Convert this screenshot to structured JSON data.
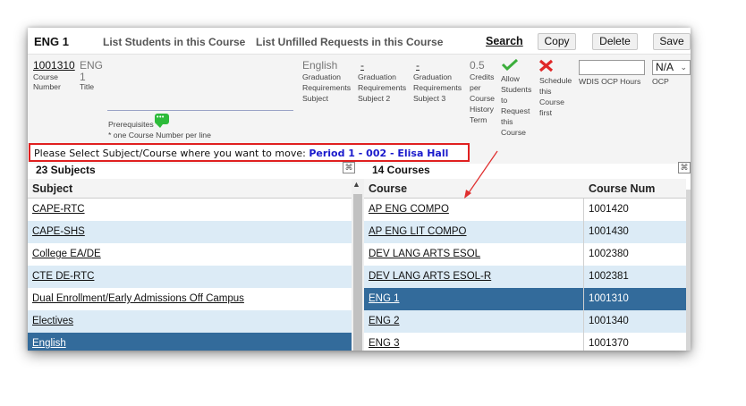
{
  "header": {
    "course_code": "ENG 1",
    "link_students": "List Students in this Course",
    "link_unfilled": "List Unfilled Requests in this Course",
    "search_label": "Search",
    "copy_label": "Copy",
    "delete_label": "Delete",
    "save_label": "Save"
  },
  "course": {
    "number_value": "1001310",
    "number_label_1": "Course",
    "number_label_2": "Number",
    "title_value_1": "ENG",
    "title_value_2": "1",
    "title_label": "Title",
    "grad_subject_value": "English",
    "grad_subject_label": [
      "Graduation",
      "Requirements",
      "Subject"
    ],
    "grad_subject2_value": "-",
    "grad_subject2_label": [
      "Graduation",
      "Requirements",
      "Subject 2"
    ],
    "grad_subject3_value": "-",
    "grad_subject3_label": [
      "Graduation",
      "Requirements",
      "Subject 3"
    ],
    "credits_value": "0.5",
    "credits_label": [
      "Credits",
      "per",
      "Course",
      "History",
      "Term"
    ],
    "allow_label": [
      "Allow",
      "Students",
      "to",
      "Request",
      "this",
      "Course"
    ],
    "schedule_label": [
      "Schedule",
      "this",
      "Course",
      "first"
    ],
    "wdis_label": "WDIS OCP Hours",
    "wdis_value": "",
    "ocp_value": "N/A",
    "ocp_label": "OCP",
    "prereq_label": "Prerequisites",
    "prereq_note": "* one Course Number per line"
  },
  "instruction": {
    "text": "Please Select Subject/Course where you want to move: ",
    "target": "Period 1 - 002 - Elisa Hall"
  },
  "subjects": {
    "title": "23 Subjects",
    "column": "Subject",
    "items": [
      "CAPE-RTC",
      "CAPE-SHS",
      "College EA/DE",
      "CTE DE-RTC",
      "Dual Enrollment/Early Admissions Off Campus",
      "Electives",
      "English"
    ],
    "selected_index": 6
  },
  "courses": {
    "title": "14 Courses",
    "col_course": "Course",
    "col_num": "Course Num",
    "rows": [
      {
        "course": "AP ENG COMPO",
        "num": "1001420"
      },
      {
        "course": "AP ENG LIT COMPO",
        "num": "1001430"
      },
      {
        "course": "DEV LANG ARTS ESOL",
        "num": "1002380"
      },
      {
        "course": "DEV LANG ARTS ESOL-R",
        "num": "1002381"
      },
      {
        "course": "ENG 1",
        "num": "1001310"
      },
      {
        "course": "ENG 2",
        "num": "1001340"
      },
      {
        "course": "ENG 3",
        "num": "1001370"
      }
    ],
    "selected_index": 4
  },
  "colors": {
    "selected_row": "#336b9b",
    "alt_row": "#dcebf6",
    "highlight_border": "#e02020",
    "instruction_target": "#1a1acc"
  },
  "icons": [
    "check-icon",
    "x-icon",
    "prereq-chat-icon",
    "expand-icon",
    "scroll-up-icon",
    "chevron-down-icon"
  ]
}
